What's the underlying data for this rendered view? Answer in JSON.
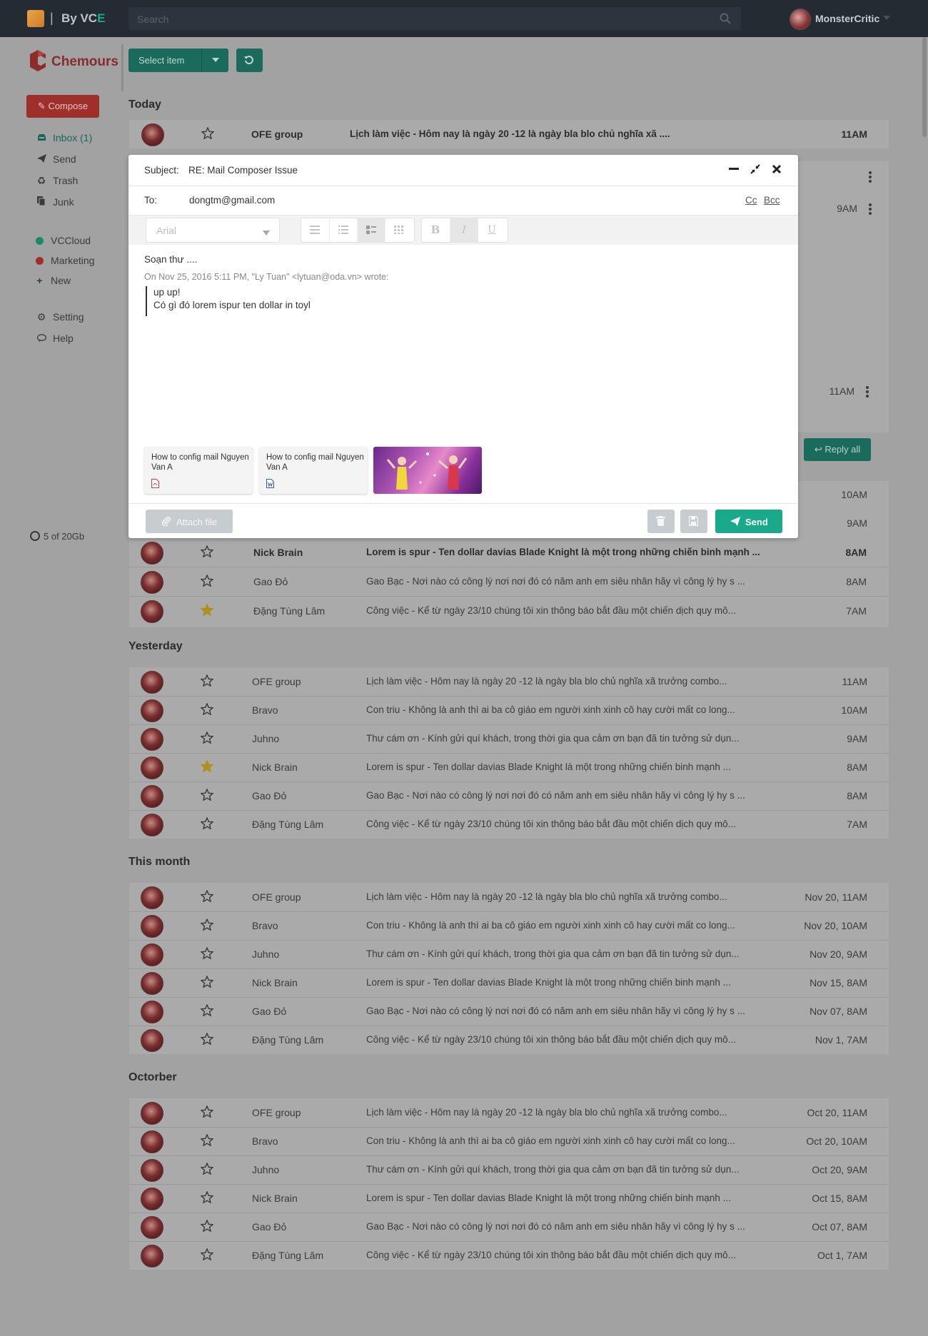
{
  "app": {
    "brand_prefix": "By ",
    "brand_main": "VC",
    "brand_accent": "E"
  },
  "search": {
    "placeholder": "Search"
  },
  "user": {
    "name": "MonsterCritic"
  },
  "sidebar": {
    "logo": "Chemours",
    "compose": "Compose",
    "nav": [
      {
        "label": "Inbox (1)",
        "icon": "inbox-icon"
      },
      {
        "label": "Send",
        "icon": "paper-plane-icon"
      },
      {
        "label": "Trash",
        "icon": "recycle-icon"
      },
      {
        "label": "Junk",
        "icon": "copy-icon"
      }
    ],
    "labels": [
      {
        "label": "VCCloud",
        "color": "#1a8a6a"
      },
      {
        "label": "Marketing",
        "color": "#9e2f2a"
      },
      {
        "label": "New"
      }
    ],
    "bottom": [
      {
        "label": "Setting",
        "icon": "gear-icon"
      },
      {
        "label": "Help",
        "icon": "chat-icon"
      }
    ],
    "storage": "5 of 20Gb"
  },
  "toolbar": {
    "select": "Select item"
  },
  "sections": {
    "today": "Today",
    "yesterday": "Yesterday",
    "this_month": "This month",
    "october": "Octorber"
  },
  "today_rows": [
    {
      "sender": "OFE group",
      "subject": "Lịch làm việc - Hôm nay là ngày  20 -12 là ngày bla blo chủ nghĩa xã ....",
      "time": "11AM",
      "starred": false,
      "bold": true
    },
    {
      "sender": "Nick Brain",
      "subject": "Lorem is spur - Ten dollar davias Blade Knight là một trong những chiến binh mạnh ...",
      "time": "8AM",
      "starred": false,
      "bold": true
    },
    {
      "sender": "Gao Đỏ",
      "subject": "Gao Bạc - Nơi nào có công lý nơi nơi đó có năm anh em siêu nhân hãy vì công lý hy s ...",
      "time": "8AM",
      "starred": false,
      "bold": false
    },
    {
      "sender": "Đặng Tùng Lâm",
      "subject": "Công việc - Kể từ ngày 23/10 chúng tôi xin thông báo bắt đầu một chiến dịch quy mô...",
      "time": "7AM",
      "starred": true,
      "bold": false
    }
  ],
  "hidden_times": {
    "t1": "9AM",
    "t2": "11AM",
    "t3": "10AM",
    "t4": "9AM"
  },
  "reply_all": "Reply all",
  "yesterday_rows": [
    {
      "sender": "OFE group",
      "subject": "Lịch làm việc - Hôm nay là ngày  20 -12 là ngày bla blo chủ nghĩa xã trưởng combo...",
      "time": "11AM",
      "starred": false
    },
    {
      "sender": "Bravo",
      "subject": "Con triu - Không là anh thì ai ba cô giáo em người xinh xinh cô hay cười mất co long...",
      "time": "10AM",
      "starred": false
    },
    {
      "sender": "Juhno",
      "subject": "Thư cám ơn - Kính gửi quí khách, trong thời gia qua cảm ơn bạn đã tin tưởng sử dụn...",
      "time": "9AM",
      "starred": false
    },
    {
      "sender": "Nick Brain",
      "subject": "Lorem is spur - Ten dollar davias Blade Knight là một trong những chiến binh mạnh ...",
      "time": "8AM",
      "starred": true
    },
    {
      "sender": "Gao Đỏ",
      "subject": "Gao Bạc - Nơi nào có công lý nơi nơi đó có năm anh em siêu nhân hãy vì công lý hy s ...",
      "time": "8AM",
      "starred": false
    },
    {
      "sender": "Đặng Tùng Lâm",
      "subject": "Công việc - Kể từ ngày 23/10 chúng tôi xin thông báo bắt đầu một chiến dịch quy mô...",
      "time": "7AM",
      "starred": false
    }
  ],
  "month_rows": [
    {
      "sender": "OFE group",
      "subject": "Lịch làm việc - Hôm nay là ngày  20 -12 là ngày bla blo chủ nghĩa xã trưởng combo...",
      "time": "Nov 20, 11AM",
      "starred": false
    },
    {
      "sender": "Bravo",
      "subject": "Con triu - Không là anh thì ai ba cô giáo em người xinh xinh cô hay cười mất co long...",
      "time": "Nov 20, 10AM",
      "starred": false
    },
    {
      "sender": "Juhno",
      "subject": "Thư cám ơn - Kính gửi quí khách, trong thời gia qua cảm ơn bạn đã tin tưởng sử dụn...",
      "time": "Nov 20, 9AM",
      "starred": false
    },
    {
      "sender": "Nick Brain",
      "subject": "Lorem is spur - Ten dollar davias Blade Knight là một trong những chiến binh mạnh ...",
      "time": "Nov 15, 8AM",
      "starred": false
    },
    {
      "sender": "Gao Đỏ",
      "subject": "Gao Bạc - Nơi nào có công lý nơi nơi đó có năm anh em siêu nhân hãy vì công lý hy s ...",
      "time": "Nov 07, 8AM",
      "starred": false
    },
    {
      "sender": "Đặng Tùng Lâm",
      "subject": "Công việc - Kể từ ngày 23/10 chúng tôi xin thông báo bắt đầu một chiến dịch quy mô...",
      "time": "Nov 1, 7AM",
      "starred": false
    }
  ],
  "october_rows": [
    {
      "sender": "OFE group",
      "subject": "Lịch làm việc - Hôm nay là ngày  20 -12 là ngày bla blo chủ nghĩa xã trưởng combo...",
      "time": "Oct 20, 11AM",
      "starred": false
    },
    {
      "sender": "Bravo",
      "subject": "Con triu - Không là anh thì ai ba cô giáo em người xinh xinh cô hay cười mất co long...",
      "time": "Oct 20, 10AM",
      "starred": false
    },
    {
      "sender": "Juhno",
      "subject": "Thư cám ơn - Kính gửi quí khách, trong thời gia qua cảm ơn bạn đã tin tưởng sử dụn...",
      "time": "Oct 20, 9AM",
      "starred": false
    },
    {
      "sender": "Nick Brain",
      "subject": "Lorem is spur - Ten dollar davias Blade Knight là một trong những chiến binh mạnh ...",
      "time": "Oct 15, 8AM",
      "starred": false
    },
    {
      "sender": "Gao Đỏ",
      "subject": "Gao Bạc - Nơi nào có công lý nơi nơi đó có năm anh em siêu nhân hãy vì công lý hy s ...",
      "time": "Oct 07, 8AM",
      "starred": false
    },
    {
      "sender": "Đặng Tùng Lâm",
      "subject": "Công việc - Kể từ ngày 23/10 chúng tôi xin thông báo bắt đầu một chiến dịch quy mô...",
      "time": "Oct 1, 7AM",
      "starred": false
    }
  ],
  "composer": {
    "subject_label": "Subject:",
    "subject": "RE: Mail Composer Issue",
    "to_label": "To:",
    "to": "dongtm@gmail.com",
    "cc": "Cc",
    "bcc": "Bcc",
    "font": "Arial",
    "format_buttons": [
      "B",
      "I",
      "U"
    ],
    "body_line": "Soạn thư ....",
    "quote_header": "On Nov 25, 2016 5:11 PM, \"Ly Tuan\" <lytuan@oda.vn> wrote:",
    "quote_lines": [
      "up up!",
      "Có gì đó lorem ispur ten dollar in toyl"
    ],
    "attachments": [
      {
        "name": "How to config mail Nguyen Van A",
        "type": "pdf"
      },
      {
        "name": "How to config mail Nguyen Van A",
        "type": "doc"
      }
    ],
    "attach_file": "Attach file",
    "send": "Send"
  },
  "colors": {
    "topbar": "#252b33",
    "accent": "#1ba98c",
    "compose": "#9e2f2a"
  }
}
